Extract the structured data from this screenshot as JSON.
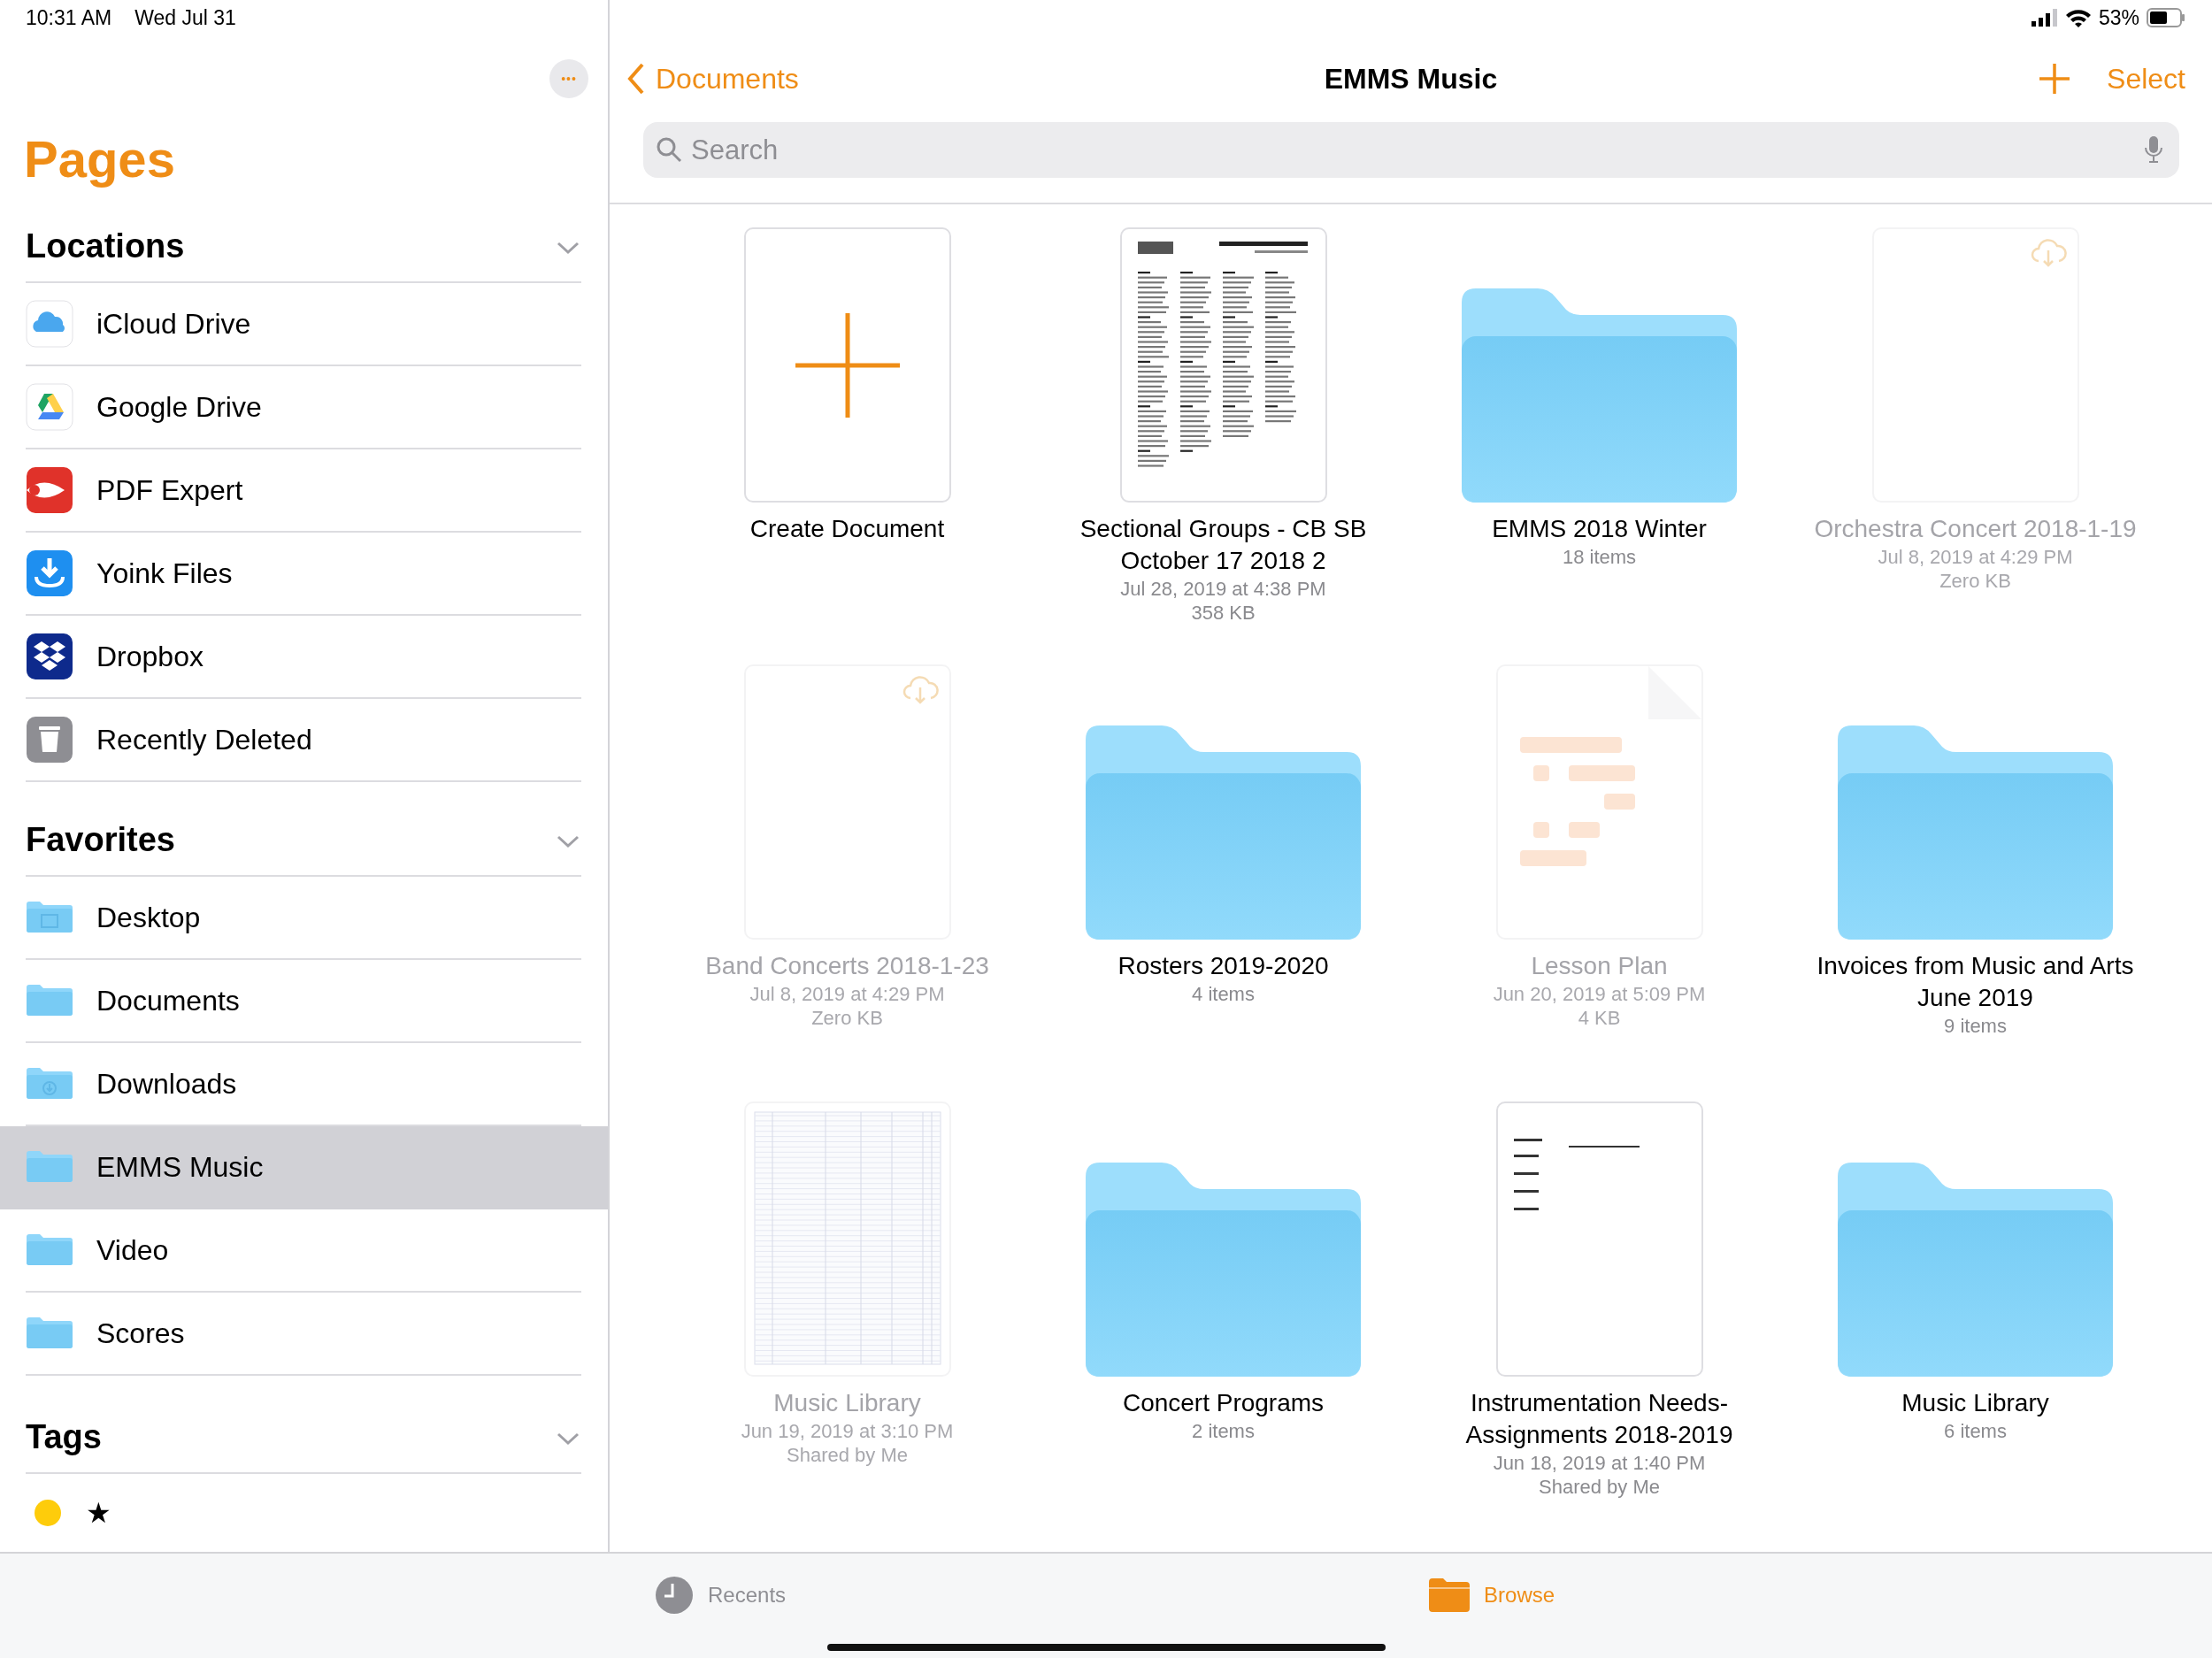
{
  "status_bar": {
    "time": "10:31 AM",
    "date": "Wed Jul 31",
    "battery": "53%"
  },
  "sidebar": {
    "title": "Pages",
    "more_button": "•••",
    "sections": [
      {
        "title": "Locations",
        "expanded": true,
        "items": [
          {
            "label": "iCloud Drive",
            "kind": "icloud",
            "selected": false
          },
          {
            "label": "Google Drive",
            "kind": "gdrive",
            "selected": false
          },
          {
            "label": "PDF Expert",
            "kind": "pdf",
            "selected": false
          },
          {
            "label": "Yoink Files",
            "kind": "yoink",
            "selected": false
          },
          {
            "label": "Dropbox",
            "kind": "dropbox",
            "selected": false
          },
          {
            "label": "Recently Deleted",
            "kind": "trash",
            "selected": false
          }
        ]
      },
      {
        "title": "Favorites",
        "expanded": true,
        "items": [
          {
            "label": "Desktop",
            "kind": "desktop",
            "selected": false
          },
          {
            "label": "Documents",
            "kind": "folder",
            "selected": false
          },
          {
            "label": "Downloads",
            "kind": "downloads",
            "selected": false
          },
          {
            "label": "EMMS Music",
            "kind": "folder",
            "selected": true
          },
          {
            "label": "Video",
            "kind": "folder",
            "selected": false
          },
          {
            "label": "Scores",
            "kind": "folder",
            "selected": false
          }
        ]
      }
    ],
    "tags": {
      "title": "Tags",
      "expanded": true,
      "items": [
        {
          "kind": "color",
          "color": "#fecc0b"
        },
        {
          "kind": "symbol",
          "label": "★"
        }
      ]
    }
  },
  "navigation": {
    "back": "Documents",
    "title": "EMMS Music",
    "select": "Select"
  },
  "search": {
    "placeholder": "Search"
  },
  "files": [
    {
      "kind": "create",
      "name": "Create Document"
    },
    {
      "kind": "roster",
      "available": true,
      "cloud": false,
      "name": "Sectional Groups - CB SB October 17 2018 2",
      "details": [
        "Jul 28, 2019 at 4:38 PM",
        "358 KB"
      ]
    },
    {
      "kind": "folder",
      "name": "EMMS 2018 Winter",
      "details": [
        "18 items"
      ]
    },
    {
      "kind": "blank",
      "available": false,
      "cloud": true,
      "name": "Orchestra Concert 2018-1-19",
      "details": [
        "Jul 8, 2019 at 4:29 PM",
        "Zero KB"
      ]
    },
    {
      "kind": "blank",
      "available": false,
      "cloud": true,
      "name": "Band Concerts 2018-1-23",
      "details": [
        "Jul 8, 2019 at 4:29 PM",
        "Zero KB"
      ]
    },
    {
      "kind": "folder",
      "name": "Rosters 2019-2020",
      "details": [
        "4 items"
      ]
    },
    {
      "kind": "pages",
      "available": false,
      "cloud": false,
      "name": "Lesson Plan",
      "details": [
        "Jun 20, 2019 at 5:09 PM",
        "4 KB"
      ]
    },
    {
      "kind": "folder",
      "name": "Invoices from Music and Arts June 2019",
      "details": [
        "9 items"
      ]
    },
    {
      "kind": "table",
      "available": false,
      "cloud": false,
      "name": "Music Library",
      "details": [
        "Jun 19, 2019 at 3:10 PM",
        "Shared by Me"
      ]
    },
    {
      "kind": "folder",
      "name": "Concert Programs",
      "details": [
        "2 items"
      ]
    },
    {
      "kind": "form",
      "available": true,
      "cloud": false,
      "name": "Instrumentation Needs-Assignments 2018-2019",
      "details": [
        "Jun 18, 2019 at 1:40 PM",
        "Shared by Me"
      ]
    },
    {
      "kind": "folder",
      "name": "Music Library",
      "details": [
        "6 items"
      ]
    }
  ],
  "tab_bar": [
    {
      "label": "Recents",
      "kind": "recents",
      "selected": false
    },
    {
      "label": "Browse",
      "kind": "browse",
      "selected": true
    }
  ]
}
